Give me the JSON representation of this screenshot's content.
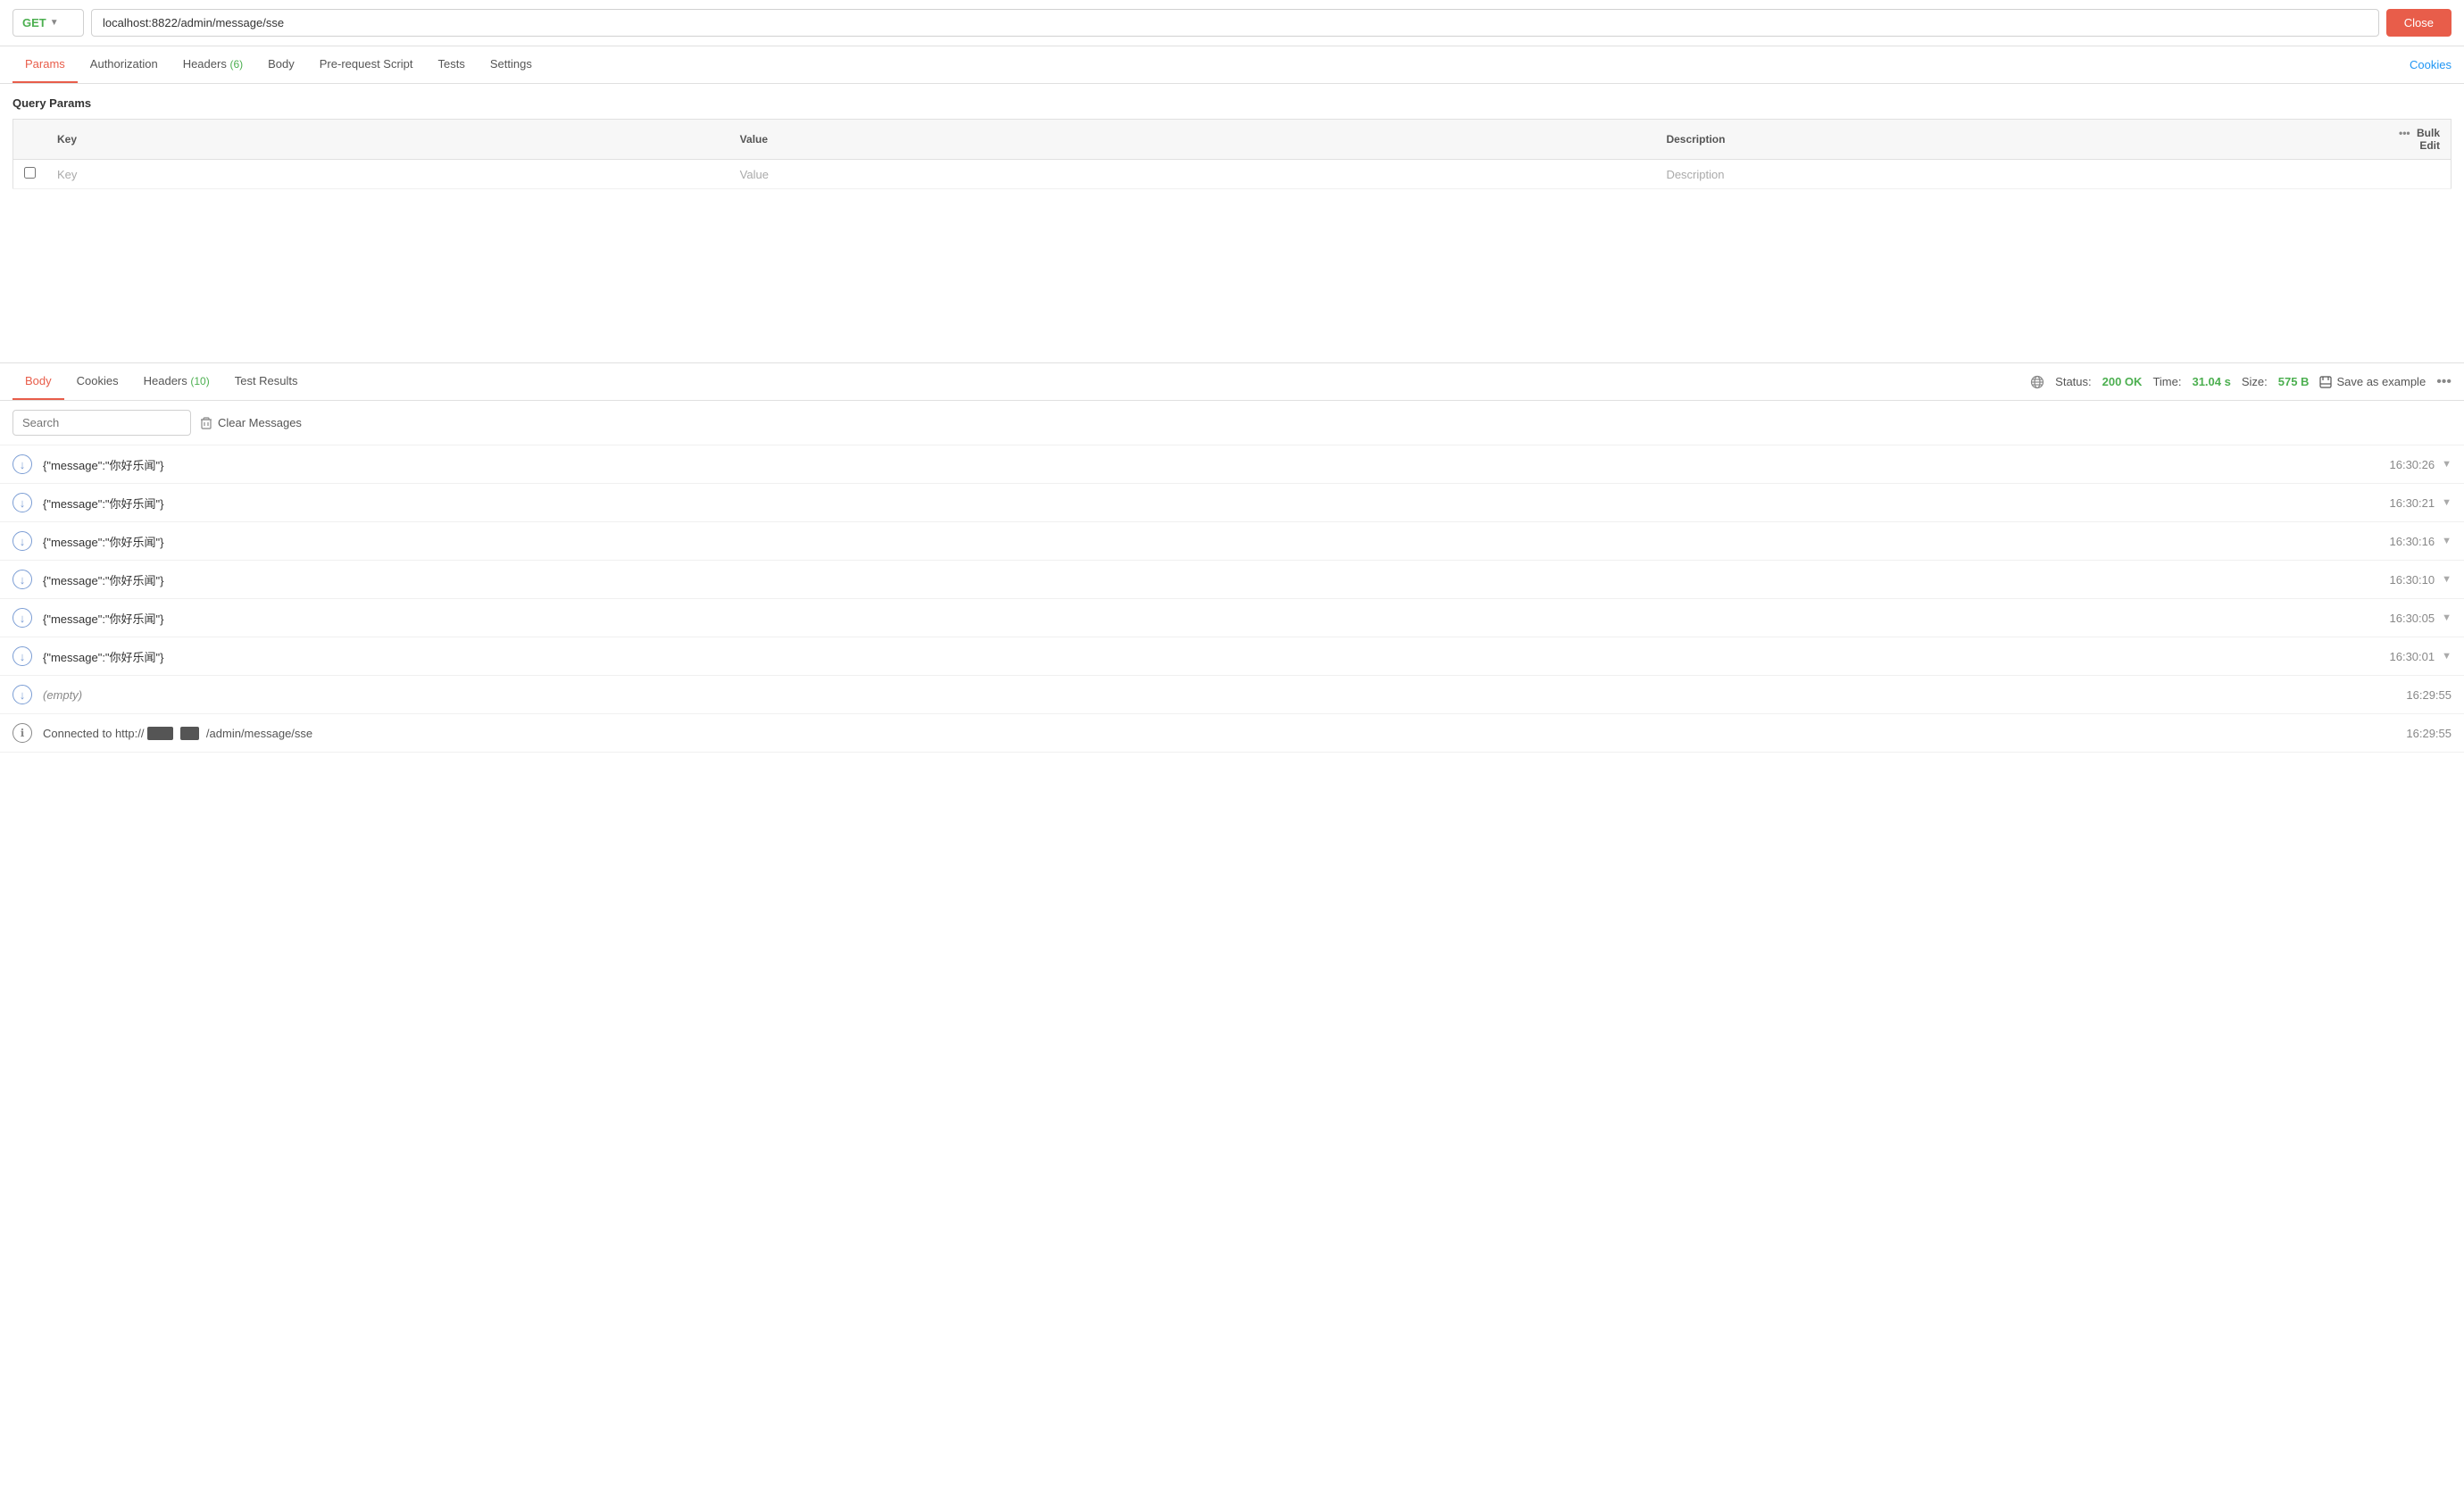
{
  "url_bar": {
    "method": "GET",
    "url": "localhost:8822/admin/message/sse",
    "close_label": "Close"
  },
  "request_tabs": {
    "items": [
      {
        "id": "params",
        "label": "Params",
        "active": true,
        "badge": null
      },
      {
        "id": "authorization",
        "label": "Authorization",
        "active": false,
        "badge": null
      },
      {
        "id": "headers",
        "label": "Headers",
        "active": false,
        "badge": "6"
      },
      {
        "id": "body",
        "label": "Body",
        "active": false,
        "badge": null
      },
      {
        "id": "pre-request",
        "label": "Pre-request Script",
        "active": false,
        "badge": null
      },
      {
        "id": "tests",
        "label": "Tests",
        "active": false,
        "badge": null
      },
      {
        "id": "settings",
        "label": "Settings",
        "active": false,
        "badge": null
      }
    ],
    "cookies_link": "Cookies"
  },
  "query_params": {
    "title": "Query Params",
    "columns": [
      "Key",
      "Value",
      "Description"
    ],
    "bulk_edit_label": "Bulk Edit",
    "placeholder_key": "Key",
    "placeholder_value": "Value",
    "placeholder_desc": "Description"
  },
  "response_tabs": {
    "items": [
      {
        "id": "body",
        "label": "Body",
        "active": true,
        "badge": null
      },
      {
        "id": "cookies",
        "label": "Cookies",
        "active": false,
        "badge": null
      },
      {
        "id": "headers",
        "label": "Headers",
        "active": false,
        "badge": "10"
      },
      {
        "id": "test-results",
        "label": "Test Results",
        "active": false,
        "badge": null
      }
    ],
    "status_label": "Status:",
    "status_value": "200 OK",
    "time_label": "Time:",
    "time_value": "31.04 s",
    "size_label": "Size:",
    "size_value": "575 B",
    "save_example_label": "Save as example",
    "more_icon": "•••"
  },
  "search_bar": {
    "placeholder": "Search",
    "clear_label": "Clear Messages"
  },
  "messages": [
    {
      "type": "arrow",
      "content": "{\"message\":\"你好乐闻\"}",
      "time": "16:30:26",
      "empty": false
    },
    {
      "type": "arrow",
      "content": "{\"message\":\"你好乐闻\"}",
      "time": "16:30:21",
      "empty": false
    },
    {
      "type": "arrow",
      "content": "{\"message\":\"你好乐闻\"}",
      "time": "16:30:16",
      "empty": false
    },
    {
      "type": "arrow",
      "content": "{\"message\":\"你好乐闻\"}",
      "time": "16:30:10",
      "empty": false
    },
    {
      "type": "arrow",
      "content": "{\"message\":\"你好乐闻\"}",
      "time": "16:30:05",
      "empty": false
    },
    {
      "type": "arrow",
      "content": "{\"message\":\"你好乐闻\"}",
      "time": "16:30:01",
      "empty": false
    },
    {
      "type": "arrow",
      "content": "(empty)",
      "time": "16:29:55",
      "empty": true
    },
    {
      "type": "info",
      "content": "Connected to http://",
      "time": "16:29:55",
      "empty": false,
      "connected": true
    }
  ]
}
